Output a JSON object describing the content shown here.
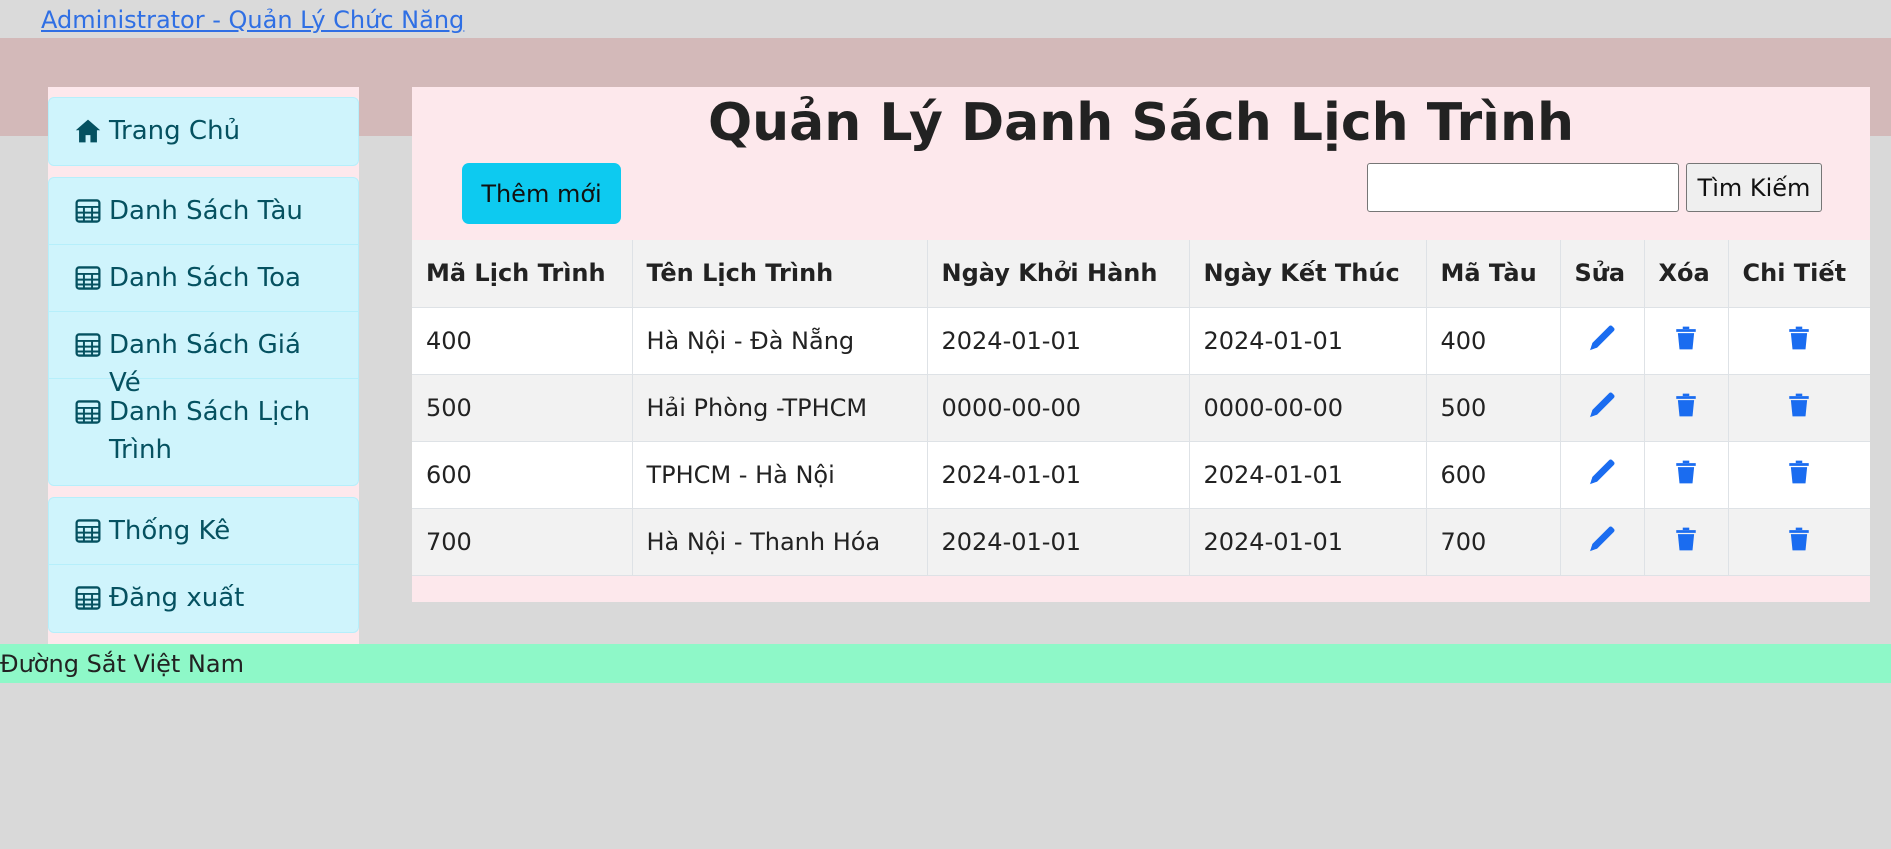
{
  "header": {
    "link_text": "Administrator - Quản Lý Chức Năng"
  },
  "sidebar": {
    "groups": [
      {
        "items": [
          {
            "label": "Trang Chủ",
            "icon": "home-icon"
          }
        ]
      },
      {
        "items": [
          {
            "label": "Danh Sách Tàu",
            "icon": "table-icon"
          },
          {
            "label": "Danh Sách Toa",
            "icon": "table-icon"
          },
          {
            "label": "Danh Sách Giá Vé",
            "icon": "table-icon"
          },
          {
            "label": "Danh Sách Lịch Trình",
            "icon": "table-icon"
          }
        ]
      },
      {
        "items": [
          {
            "label": "Thống Kê",
            "icon": "table-icon"
          },
          {
            "label": "Đăng xuất",
            "icon": "table-icon"
          }
        ]
      }
    ]
  },
  "main": {
    "title": "Quản Lý Danh Sách Lịch Trình",
    "add_label": "Thêm mới",
    "search_value": "",
    "search_label": "Tìm Kiếm",
    "columns": [
      "Mã Lịch Trình",
      "Tên Lịch Trình",
      "Ngày Khởi Hành",
      "Ngày Kết Thúc",
      "Mã Tàu",
      "Sửa",
      "Xóa",
      "Chi Tiết"
    ],
    "rows": [
      [
        "400",
        "Hà Nội - Đà Nẵng",
        "2024-01-01",
        "2024-01-01",
        "400"
      ],
      [
        "500",
        "Hải Phòng -TPHCM",
        "0000-00-00",
        "0000-00-00",
        "500"
      ],
      [
        "600",
        "TPHCM - Hà Nội",
        "2024-01-01",
        "2024-01-01",
        "600"
      ],
      [
        "700",
        "Hà Nội - Thanh Hóa",
        "2024-01-01",
        "2024-01-01",
        "700"
      ]
    ],
    "row_icons": {
      "edit": "pencil-icon",
      "delete": "trash-icon",
      "detail": "trash-icon"
    }
  },
  "footer": {
    "text": "Đường Sắt Việt Nam"
  },
  "colors": {
    "accent": "#0dcaf0",
    "icon_blue": "#1a6cf0",
    "menu_bg": "#cff4fc",
    "menu_text": "#055160",
    "footer_bg": "#8ef8c8"
  }
}
